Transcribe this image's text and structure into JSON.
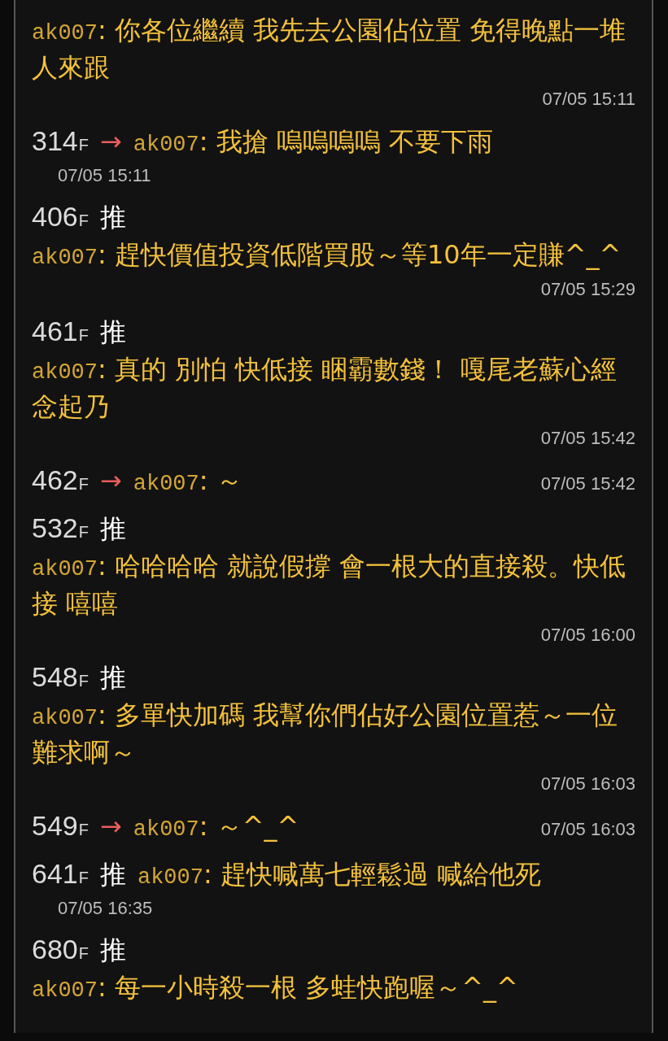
{
  "comments": [
    {
      "kind": "stacked",
      "author": "ak007",
      "text": ": 你各位繼續 我先去公園佔位置 免得晚點一堆人來跟",
      "time": "07/05 15:11"
    },
    {
      "kind": "inline",
      "floor": "314",
      "floor_unit": "F",
      "tag": {
        "kind": "arrow",
        "text": "→"
      },
      "author": "ak007",
      "text": ": 我搶 嗚嗚嗚嗚 不要下雨",
      "time": "07/05 15:11"
    },
    {
      "kind": "stacked",
      "floor": "406",
      "floor_unit": "F",
      "tag": {
        "kind": "push",
        "text": "推"
      },
      "author": "ak007",
      "text": ": 趕快價值投資低階買股～等10年一定賺^_^",
      "time": "07/05 15:29"
    },
    {
      "kind": "stacked",
      "floor": "461",
      "floor_unit": "F",
      "tag": {
        "kind": "push",
        "text": "推"
      },
      "author": "ak007",
      "text": ": 真的 別怕 快低接 睏霸數錢！ 嘎尾老蘇心經念起乃",
      "time": "07/05 15:42"
    },
    {
      "kind": "inline_right",
      "floor": "462",
      "floor_unit": "F",
      "tag": {
        "kind": "arrow",
        "text": "→"
      },
      "author": "ak007",
      "text": ": ～",
      "time": "07/05 15:42"
    },
    {
      "kind": "stacked",
      "floor": "532",
      "floor_unit": "F",
      "tag": {
        "kind": "push",
        "text": "推"
      },
      "author": "ak007",
      "text": ": 哈哈哈哈 就說假撐 會一根大的直接殺。快低接 嘻嘻",
      "time": "07/05 16:00"
    },
    {
      "kind": "stacked",
      "floor": "548",
      "floor_unit": "F",
      "tag": {
        "kind": "push",
        "text": "推"
      },
      "author": "ak007",
      "text": ": 多單快加碼 我幫你們佔好公園位置惹～一位難求啊～",
      "time": "07/05 16:03"
    },
    {
      "kind": "inline_right",
      "floor": "549",
      "floor_unit": "F",
      "tag": {
        "kind": "arrow",
        "text": "→"
      },
      "author": "ak007",
      "text": ": ～^_^",
      "time": "07/05 16:03"
    },
    {
      "kind": "inline",
      "floor": "641",
      "floor_unit": "F",
      "tag": {
        "kind": "push",
        "text": "推"
      },
      "author": "ak007",
      "text": ": 趕快喊萬七輕鬆過 喊給他死",
      "time": "07/05 16:35"
    },
    {
      "kind": "stacked",
      "floor": "680",
      "floor_unit": "F",
      "tag": {
        "kind": "push",
        "text": "推"
      },
      "author": "ak007",
      "text": ": 每一小時殺一根 多蛙快跑喔～^_^"
    }
  ]
}
